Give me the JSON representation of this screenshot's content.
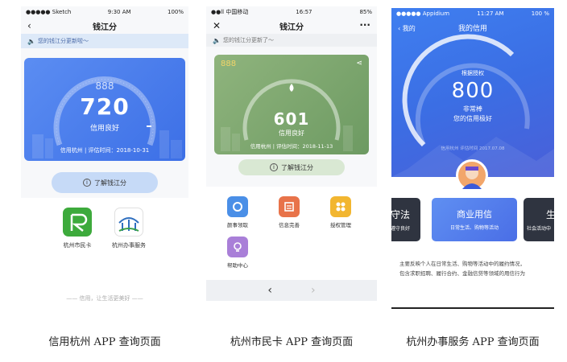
{
  "phone1": {
    "status": {
      "left": "●●●●● Sketch",
      "time": "9:30 AM",
      "battery": "100%"
    },
    "nav": {
      "title": "钱江分",
      "back": "‹"
    },
    "notice": "您的钱江分更新啦～",
    "card": {
      "score": "720",
      "level": "信用良好",
      "footer": "信用杭州 | 评估时间：2018-10-31",
      "badge": "888"
    },
    "button": "了解钱江分",
    "apps": [
      {
        "label": "杭州市民卡",
        "color": "#3daa3c"
      },
      {
        "label": "杭州办事服务",
        "color": "#ffffff"
      }
    ],
    "slogan": "信用，让生活更美好"
  },
  "phone2": {
    "status": {
      "left": "●●ll 中国移动",
      "time": "16:57",
      "battery": "85%"
    },
    "nav": {
      "title": "钱江分",
      "close": "✕",
      "more": "···"
    },
    "notice": "您的钱江分更新了～",
    "card": {
      "score": "601",
      "level": "信用良好",
      "footer": "信用杭州 | 评估时间：2018-11-13",
      "badge": "888"
    },
    "button": "了解钱江分",
    "grid": [
      {
        "label": "颜事领取",
        "color": "#4a8fe7"
      },
      {
        "label": "信息完善",
        "color": "#e8734a"
      },
      {
        "label": "授权管理",
        "color": "#f2b630"
      },
      {
        "label": "帮助中心",
        "color": "#a97fd8"
      }
    ],
    "pager": {
      "prev": "‹",
      "next": "›"
    }
  },
  "phone3": {
    "status": {
      "left": "●●●●● Appidium",
      "time": "11:27 AM",
      "battery": "100 %"
    },
    "nav": {
      "back": "‹ 我的",
      "title": "我的信用"
    },
    "card": {
      "top": "根据授权",
      "score": "800",
      "level": "非常棒",
      "desc": "您的信用极好",
      "footer": "信用杭州 评估时间 2017.07.08"
    },
    "tabs": [
      {
        "title": "守法",
        "sub": "遵守良好"
      },
      {
        "title": "商业用信",
        "sub": "日常生活、购物等活动"
      },
      {
        "title": "生",
        "sub": "社会活动中"
      }
    ],
    "desc": [
      "主要反映个人在日常生活、购物等活动中的履约情况，",
      "包含求职招聘、履行合约、金融信贷等领域的用信行为"
    ]
  },
  "captions": [
    "信用杭州 APP 查询页面",
    "杭州市民卡 APP 查询页面",
    "杭州办事服务 APP 查询页面"
  ]
}
